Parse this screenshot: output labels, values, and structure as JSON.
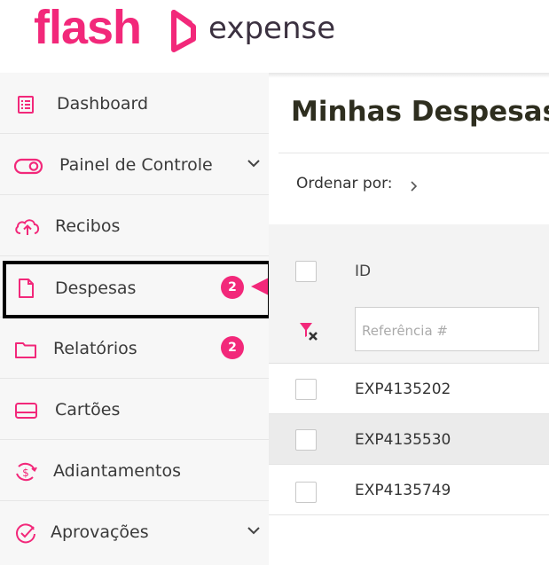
{
  "brand": {
    "name": "flash",
    "product": "expense",
    "color": "#f2287a"
  },
  "sidebar": {
    "items": [
      {
        "label": "Dashboard",
        "icon": "list-icon"
      },
      {
        "label": "Painel de Controle",
        "icon": "toggle-icon",
        "expandable": true
      },
      {
        "label": "Recibos",
        "icon": "cloud-upload-icon"
      },
      {
        "label": "Despesas",
        "icon": "document-icon",
        "badge": "2",
        "active": true
      },
      {
        "label": "Relatórios",
        "icon": "folder-icon",
        "badge": "2"
      },
      {
        "label": "Cartões",
        "icon": "card-icon"
      },
      {
        "label": "Adiantamentos",
        "icon": "dollar-cycle-icon"
      },
      {
        "label": "Aprovações",
        "icon": "check-circle-icon",
        "expandable": true
      }
    ]
  },
  "main": {
    "title": "Minhas Despesas",
    "sort_label": "Ordenar por:",
    "table": {
      "columns": [
        "ID"
      ],
      "filter_placeholder": "Referência #",
      "rows": [
        {
          "id": "EXP4135202"
        },
        {
          "id": "EXP4135530"
        },
        {
          "id": "EXP4135749"
        }
      ]
    }
  }
}
